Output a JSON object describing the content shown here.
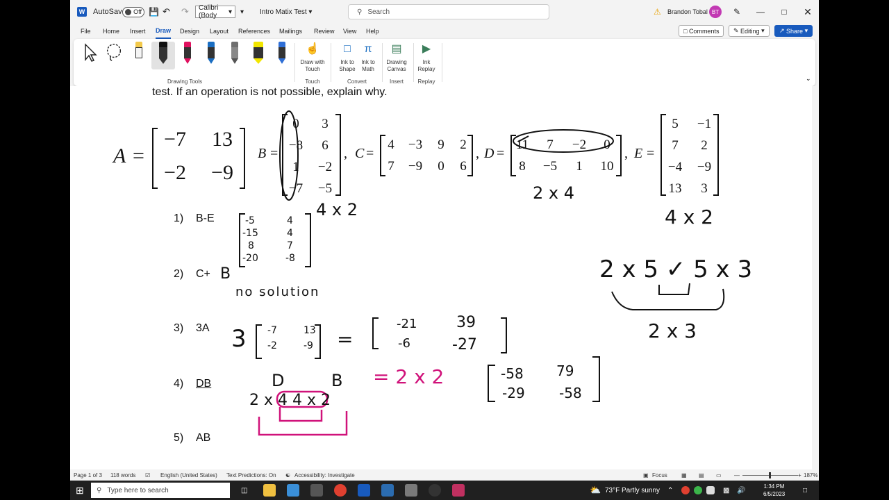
{
  "titlebar": {
    "autosave_label": "AutoSave",
    "autosave_state": "Off",
    "font_name": "Calibri (Body",
    "doc_title": "Intro Matix Test",
    "search_placeholder": "Search",
    "user_name": "Brandon Tobal",
    "user_initials": "BT"
  },
  "menu": {
    "tabs": [
      "File",
      "Home",
      "Insert",
      "Draw",
      "Design",
      "Layout",
      "References",
      "Mailings",
      "Review",
      "View",
      "Help"
    ],
    "active_tab": "Draw",
    "comments_label": "Comments",
    "editing_label": "Editing",
    "share_label": "Share"
  },
  "ribbon": {
    "drawing_tools_label": "Drawing Tools",
    "draw_with_touch": [
      "Draw with",
      "Touch"
    ],
    "ink_to_shape": [
      "Ink to",
      "Shape"
    ],
    "ink_to_math": [
      "Ink to",
      "Math"
    ],
    "drawing_canvas": [
      "Drawing",
      "Canvas"
    ],
    "ink_replay": [
      "Ink",
      "Replay"
    ],
    "groups": [
      "Touch",
      "Convert",
      "Insert",
      "Replay"
    ],
    "pen_colors": [
      "#111111",
      "#e0115f",
      "#1b6ec2",
      "#6e6e6e",
      "#f2e600",
      "#2f6fd6"
    ]
  },
  "document": {
    "intro_line": "test. If an operation is not possible, explain why.",
    "matrices": {
      "A": {
        "name": "A",
        "rows": [
          [
            "−7",
            "13"
          ],
          [
            "−2",
            "−9"
          ]
        ]
      },
      "B": {
        "name": "B",
        "rows": [
          [
            "0",
            "3"
          ],
          [
            "−8",
            "6"
          ],
          [
            "1",
            "−2"
          ],
          [
            "−7",
            "−5"
          ]
        ]
      },
      "C": {
        "name": "C",
        "rows": [
          [
            "4",
            "−3",
            "9",
            "2"
          ],
          [
            "7",
            "−9",
            "0",
            "6"
          ]
        ]
      },
      "D": {
        "name": "D",
        "rows": [
          [
            "11",
            "7",
            "−2",
            "0"
          ],
          [
            "8",
            "−5",
            "1",
            "10"
          ]
        ]
      },
      "E": {
        "name": "E",
        "rows": [
          [
            "5",
            "−1"
          ],
          [
            "7",
            "2"
          ],
          [
            "−4",
            "−9"
          ],
          [
            "13",
            "3"
          ]
        ]
      }
    },
    "problems": [
      {
        "num": "1)",
        "expr": "B-E"
      },
      {
        "num": "2)",
        "expr": "C+"
      },
      {
        "num": "3)",
        "expr": "3A"
      },
      {
        "num": "4)",
        "expr": "DB"
      },
      {
        "num": "5)",
        "expr": "AB"
      }
    ],
    "handwriting": {
      "dim_b": "4 x 2",
      "dim_d": "2 x 4",
      "dim_e": "4 x 2",
      "rule_lhs": "2 x 5 ✓ 5 x 3",
      "rule_result": "2 x 3",
      "p1_matrix": [
        [
          "-5",
          "4"
        ],
        [
          "-15",
          "4"
        ],
        [
          "8",
          "7"
        ],
        [
          "-20",
          "-8"
        ]
      ],
      "p2_b": "B",
      "p2_note": "no solution",
      "p3_lhs": "3",
      "p3_lhs_matrix": [
        [
          "-7",
          "13"
        ],
        [
          "-2",
          "-9"
        ]
      ],
      "p3_eq": "=",
      "p3_rhs_matrix": [
        [
          "-21",
          "39"
        ],
        [
          "-6",
          "-27"
        ]
      ],
      "p4_d": "D",
      "p4_b": "B",
      "p4_dims": "2 x 4   4 x 2",
      "p4_result": "= 2 x 2",
      "p4_matrix": [
        [
          "-58",
          "79"
        ],
        [
          "-29",
          "-58"
        ]
      ]
    }
  },
  "status": {
    "page": "Page 1 of 3",
    "words": "118 words",
    "language": "English (United States)",
    "predictions": "Text Predictions: On",
    "accessibility": "Accessibility: Investigate",
    "focus": "Focus",
    "zoom": "187%"
  },
  "taskbar": {
    "search_placeholder": "Type here to search",
    "weather": "73°F  Partly sunny",
    "time": "1:34 PM",
    "date": "6/5/2023"
  }
}
